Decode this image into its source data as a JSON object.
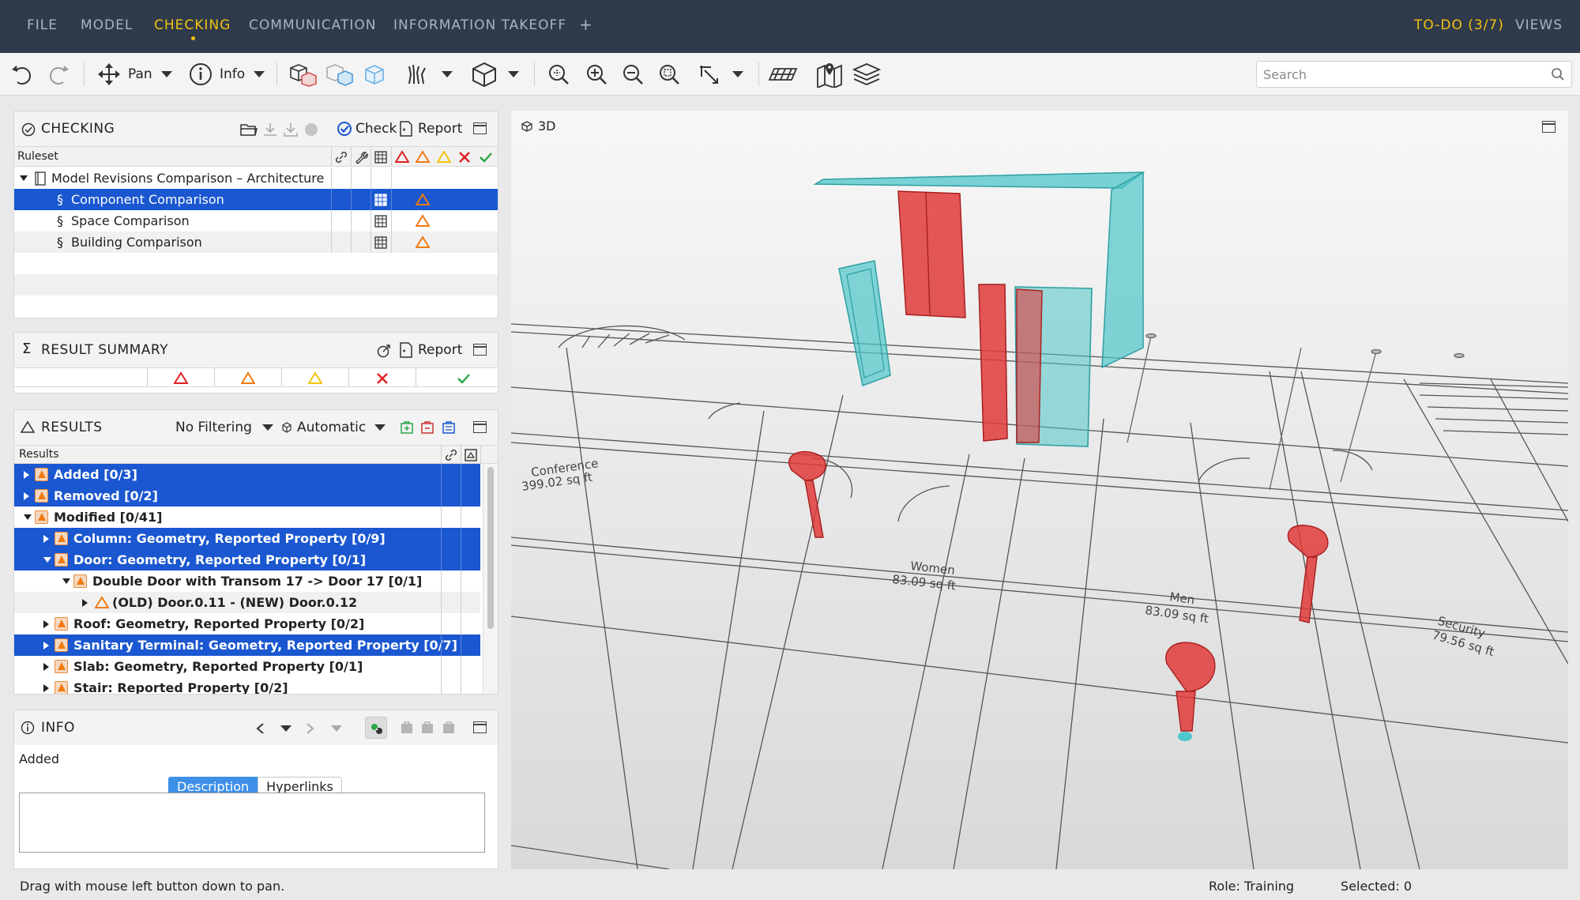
{
  "menubar": {
    "items": [
      "FILE",
      "MODEL",
      "CHECKING",
      "COMMUNICATION",
      "INFORMATION TAKEOFF",
      "+"
    ],
    "active": "CHECKING",
    "right": {
      "todo": "TO-DO (3/7)",
      "views": "VIEWS"
    }
  },
  "toolbar": {
    "pan_label": "Pan",
    "info_label": "Info",
    "search_placeholder": "Search"
  },
  "checking": {
    "title": "CHECKING",
    "check_label": "Check",
    "report_label": "Report",
    "ruleset_header": "Ruleset",
    "root": "Model Revisions Comparison – Architecture",
    "rules": [
      {
        "label": "Component Comparison",
        "selected": true
      },
      {
        "label": "Space Comparison",
        "selected": false
      },
      {
        "label": "Building Comparison",
        "selected": false
      }
    ]
  },
  "summary": {
    "title": "RESULT SUMMARY",
    "report_label": "Report"
  },
  "results": {
    "title": "RESULTS",
    "filter": "No Filtering",
    "mode": "Automatic",
    "header": "Results",
    "rows": [
      {
        "label": "Added [0/3]",
        "level": 0,
        "state": "collapsed",
        "selected": true
      },
      {
        "label": "Removed [0/2]",
        "level": 0,
        "state": "collapsed",
        "selected": true
      },
      {
        "label": "Modified [0/41]",
        "level": 0,
        "state": "expanded",
        "selected": false
      },
      {
        "label": "Column: Geometry, Reported Property [0/9]",
        "level": 1,
        "state": "collapsed",
        "selected": true
      },
      {
        "label": "Door: Geometry, Reported Property [0/1]",
        "level": 1,
        "state": "expanded",
        "selected": true
      },
      {
        "label": "Double Door with Transom 17 -> Door 17 [0/1]",
        "level": 2,
        "state": "expanded",
        "selected": false
      },
      {
        "label": "(OLD) Door.0.11 - (NEW) Door.0.12",
        "level": 3,
        "state": "collapsed",
        "selected": false
      },
      {
        "label": "Roof: Geometry, Reported Property [0/2]",
        "level": 1,
        "state": "collapsed",
        "selected": false
      },
      {
        "label": "Sanitary Terminal: Geometry, Reported Property [0/7]",
        "level": 1,
        "state": "collapsed",
        "selected": true
      },
      {
        "label": "Slab: Geometry, Reported Property [0/1]",
        "level": 1,
        "state": "collapsed",
        "selected": false
      },
      {
        "label": "Stair: Reported Property [0/2]",
        "level": 1,
        "state": "collapsed",
        "selected": false
      }
    ]
  },
  "info": {
    "title": "INFO",
    "value": "Added",
    "tabs": [
      "Description",
      "Hyperlinks"
    ],
    "active_tab": "Description"
  },
  "viewport": {
    "title": "3D",
    "room_labels": [
      {
        "name": "Conference",
        "area": "399.02 sq ft"
      },
      {
        "name": "Women",
        "area": "83.09 sq ft"
      },
      {
        "name": "Men",
        "area": "83.09 sq ft"
      },
      {
        "name": "Security",
        "area": "79.56 sq ft"
      }
    ]
  },
  "status": {
    "hint": "Drag with mouse left button down to pan.",
    "role": "Role: Training",
    "selected": "Selected: 0"
  },
  "colors": {
    "menubar_bg": "#2f3a4a",
    "accent": "#f1c40f",
    "selection": "#1a57d0",
    "new_element": "#4fc6c9",
    "removed_element": "#e03b3b"
  }
}
